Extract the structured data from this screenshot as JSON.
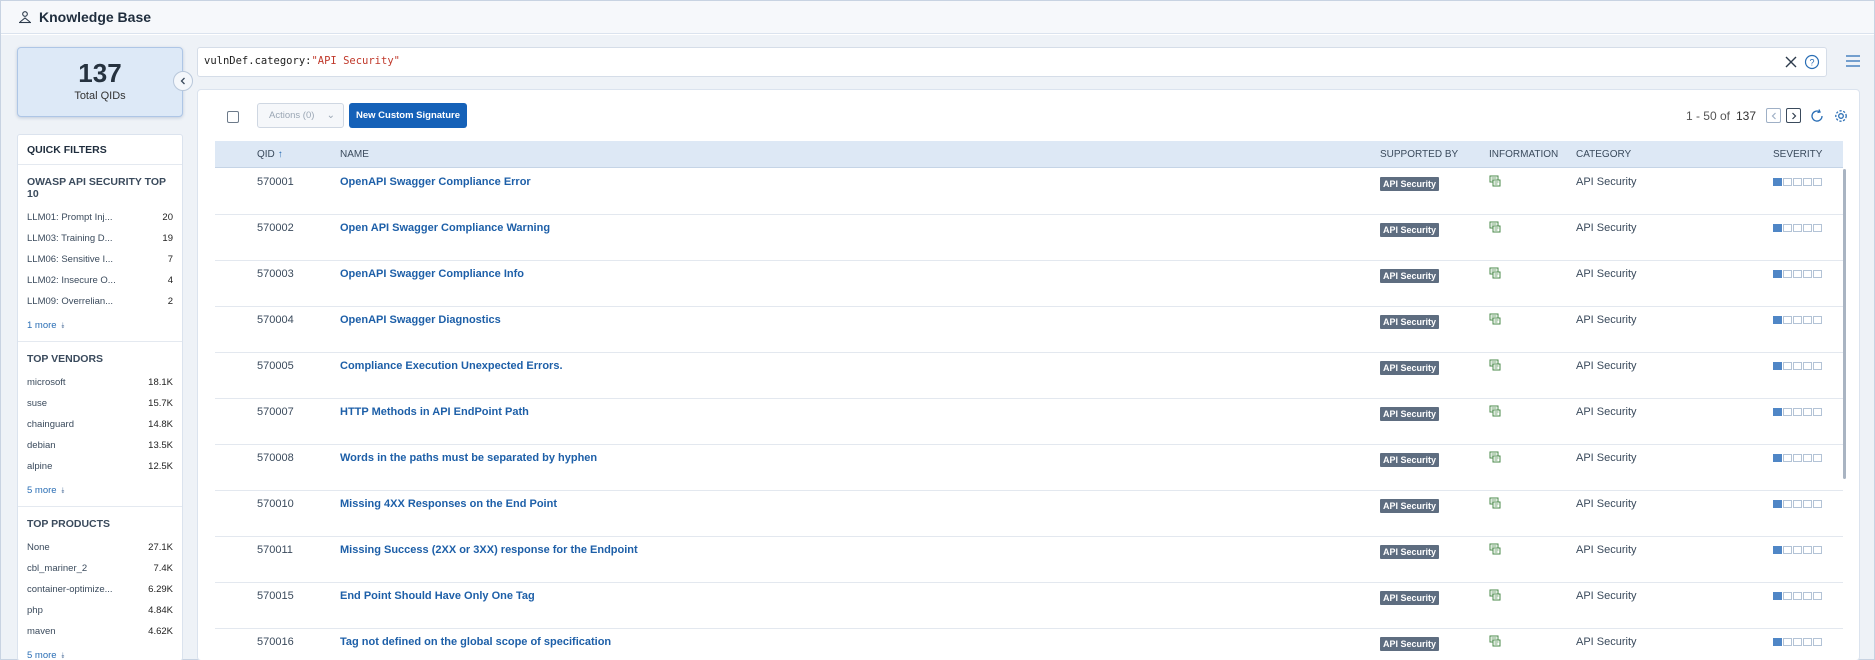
{
  "app": {
    "title": "Knowledge Base"
  },
  "summary": {
    "total": "137",
    "total_label": "Total QIDs"
  },
  "search": {
    "query_key": "vulnDef.category:",
    "query_value": "\"API Security\""
  },
  "filters": {
    "title": "QUICK FILTERS",
    "groups": [
      {
        "title": "OWASP API SECURITY TOP 10",
        "items": [
          {
            "label": "LLM01: Prompt Inj...",
            "count": "20"
          },
          {
            "label": "LLM03: Training D...",
            "count": "19"
          },
          {
            "label": "LLM06: Sensitive I...",
            "count": "7"
          },
          {
            "label": "LLM02: Insecure O...",
            "count": "4"
          },
          {
            "label": "LLM09: Overrelian...",
            "count": "2"
          }
        ],
        "more": "1 more"
      },
      {
        "title": "TOP VENDORS",
        "items": [
          {
            "label": "microsoft",
            "count": "18.1K"
          },
          {
            "label": "suse",
            "count": "15.7K"
          },
          {
            "label": "chainguard",
            "count": "14.8K"
          },
          {
            "label": "debian",
            "count": "13.5K"
          },
          {
            "label": "alpine",
            "count": "12.5K"
          }
        ],
        "more": "5 more"
      },
      {
        "title": "TOP PRODUCTS",
        "items": [
          {
            "label": "None",
            "count": "27.1K"
          },
          {
            "label": "cbl_mariner_2",
            "count": "7.4K"
          },
          {
            "label": "container-optimize...",
            "count": "6.29K"
          },
          {
            "label": "php",
            "count": "4.84K"
          },
          {
            "label": "maven",
            "count": "4.62K"
          }
        ],
        "more": "5 more"
      }
    ]
  },
  "toolbar": {
    "actions_label": "Actions (0)",
    "new_label": "New Custom Signature",
    "range": "1 - 50 of",
    "total": "137"
  },
  "table": {
    "headers": {
      "qid": "QID",
      "name": "NAME",
      "supported_by": "SUPPORTED BY",
      "information": "INFORMATION",
      "category": "CATEGORY",
      "severity": "SEVERITY"
    },
    "rows": [
      {
        "qid": "570001",
        "name": "OpenAPI Swagger Compliance Error",
        "supported_by": "API Security",
        "category": "API Security",
        "severity": 1
      },
      {
        "qid": "570002",
        "name": "Open API Swagger Compliance Warning",
        "supported_by": "API Security",
        "category": "API Security",
        "severity": 1
      },
      {
        "qid": "570003",
        "name": "OpenAPI Swagger Compliance Info",
        "supported_by": "API Security",
        "category": "API Security",
        "severity": 1
      },
      {
        "qid": "570004",
        "name": "OpenAPI Swagger Diagnostics",
        "supported_by": "API Security",
        "category": "API Security",
        "severity": 1
      },
      {
        "qid": "570005",
        "name": "Compliance Execution Unexpected Errors.",
        "supported_by": "API Security",
        "category": "API Security",
        "severity": 1
      },
      {
        "qid": "570007",
        "name": "HTTP Methods in API EndPoint Path",
        "supported_by": "API Security",
        "category": "API Security",
        "severity": 1
      },
      {
        "qid": "570008",
        "name": "Words in the paths must be separated by hyphen",
        "supported_by": "API Security",
        "category": "API Security",
        "severity": 1
      },
      {
        "qid": "570010",
        "name": "Missing 4XX Responses on the End Point",
        "supported_by": "API Security",
        "category": "API Security",
        "severity": 1
      },
      {
        "qid": "570011",
        "name": "Missing Success (2XX or 3XX) response for the Endpoint",
        "supported_by": "API Security",
        "category": "API Security",
        "severity": 1
      },
      {
        "qid": "570015",
        "name": "End Point Should Have Only One Tag",
        "supported_by": "API Security",
        "category": "API Security",
        "severity": 1
      },
      {
        "qid": "570016",
        "name": "Tag not defined on the global scope of specification",
        "supported_by": "API Security",
        "category": "API Security",
        "severity": 1
      }
    ]
  },
  "colors": {
    "accent": "#1561b8",
    "link": "#1d5fa8",
    "badge": "#5e6d80",
    "severity_on": "#4f86c6"
  }
}
